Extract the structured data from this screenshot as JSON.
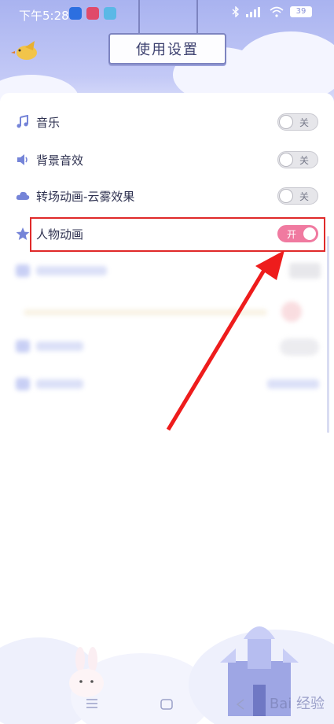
{
  "status_bar": {
    "time": "下午5:28",
    "battery": "39"
  },
  "header": {
    "title": "使用设置"
  },
  "settings": [
    {
      "label": "音乐",
      "icon": "music-note-icon",
      "toggle": "关",
      "on": false
    },
    {
      "label": "背景音效",
      "icon": "speaker-icon",
      "toggle": "关",
      "on": false
    },
    {
      "label": "转场动画-云雾效果",
      "icon": "cloud-icon",
      "toggle": "关",
      "on": false
    },
    {
      "label": "人物动画",
      "icon": "star-icon",
      "toggle": "开",
      "on": true
    }
  ],
  "colors": {
    "accent_pink": "#f07aa0",
    "header_lavender": "#a9b3f0",
    "highlight_red": "#e02a2a"
  },
  "watermark": "Bai 经验"
}
